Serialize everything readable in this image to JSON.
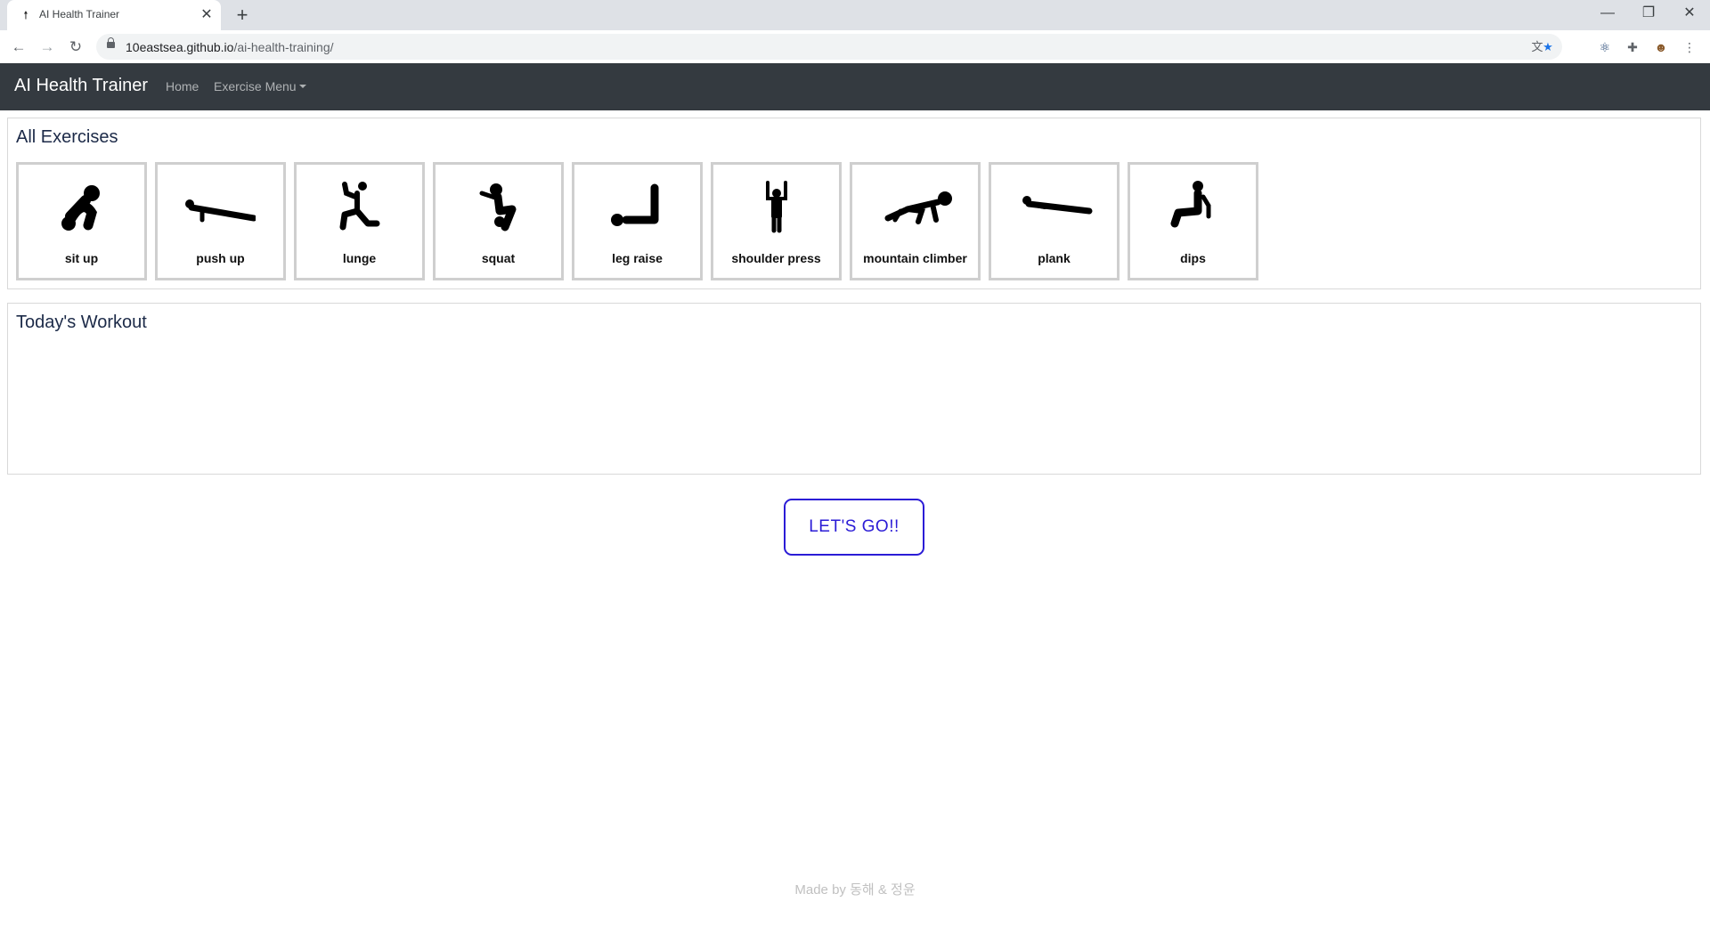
{
  "browser": {
    "tab_title": "AI Health Trainer",
    "tab_favicon_glyph": "🠕",
    "close_glyph": "✕",
    "newtab_glyph": "+",
    "url_host": "10eastsea.github.io",
    "url_path": "/ai-health-training/",
    "window_controls": {
      "minimize": "—",
      "restore": "❐",
      "close": "✕"
    }
  },
  "navbar": {
    "brand": "AI Health Trainer",
    "links": {
      "home": "Home",
      "exercise_menu": "Exercise Menu"
    }
  },
  "all_exercises": {
    "title": "All Exercises",
    "items": [
      {
        "label": "sit up",
        "icon": "sit-up-icon"
      },
      {
        "label": "push up",
        "icon": "push-up-icon"
      },
      {
        "label": "lunge",
        "icon": "lunge-icon"
      },
      {
        "label": "squat",
        "icon": "squat-icon"
      },
      {
        "label": "leg raise",
        "icon": "leg-raise-icon"
      },
      {
        "label": "shoulder press",
        "icon": "shoulder-press-icon"
      },
      {
        "label": "mountain climber",
        "icon": "mountain-climber-icon"
      },
      {
        "label": "plank",
        "icon": "plank-icon"
      },
      {
        "label": "dips",
        "icon": "dips-icon"
      }
    ]
  },
  "todays_workout": {
    "title": "Today's Workout"
  },
  "go_button": "LET'S GO!!",
  "footer": "Made by 동해 & 정윤",
  "colors": {
    "navbar_bg": "#343a40",
    "accent": "#2b1cd6",
    "card_border": "#cfcfcf",
    "title_text": "#1c2a48"
  }
}
